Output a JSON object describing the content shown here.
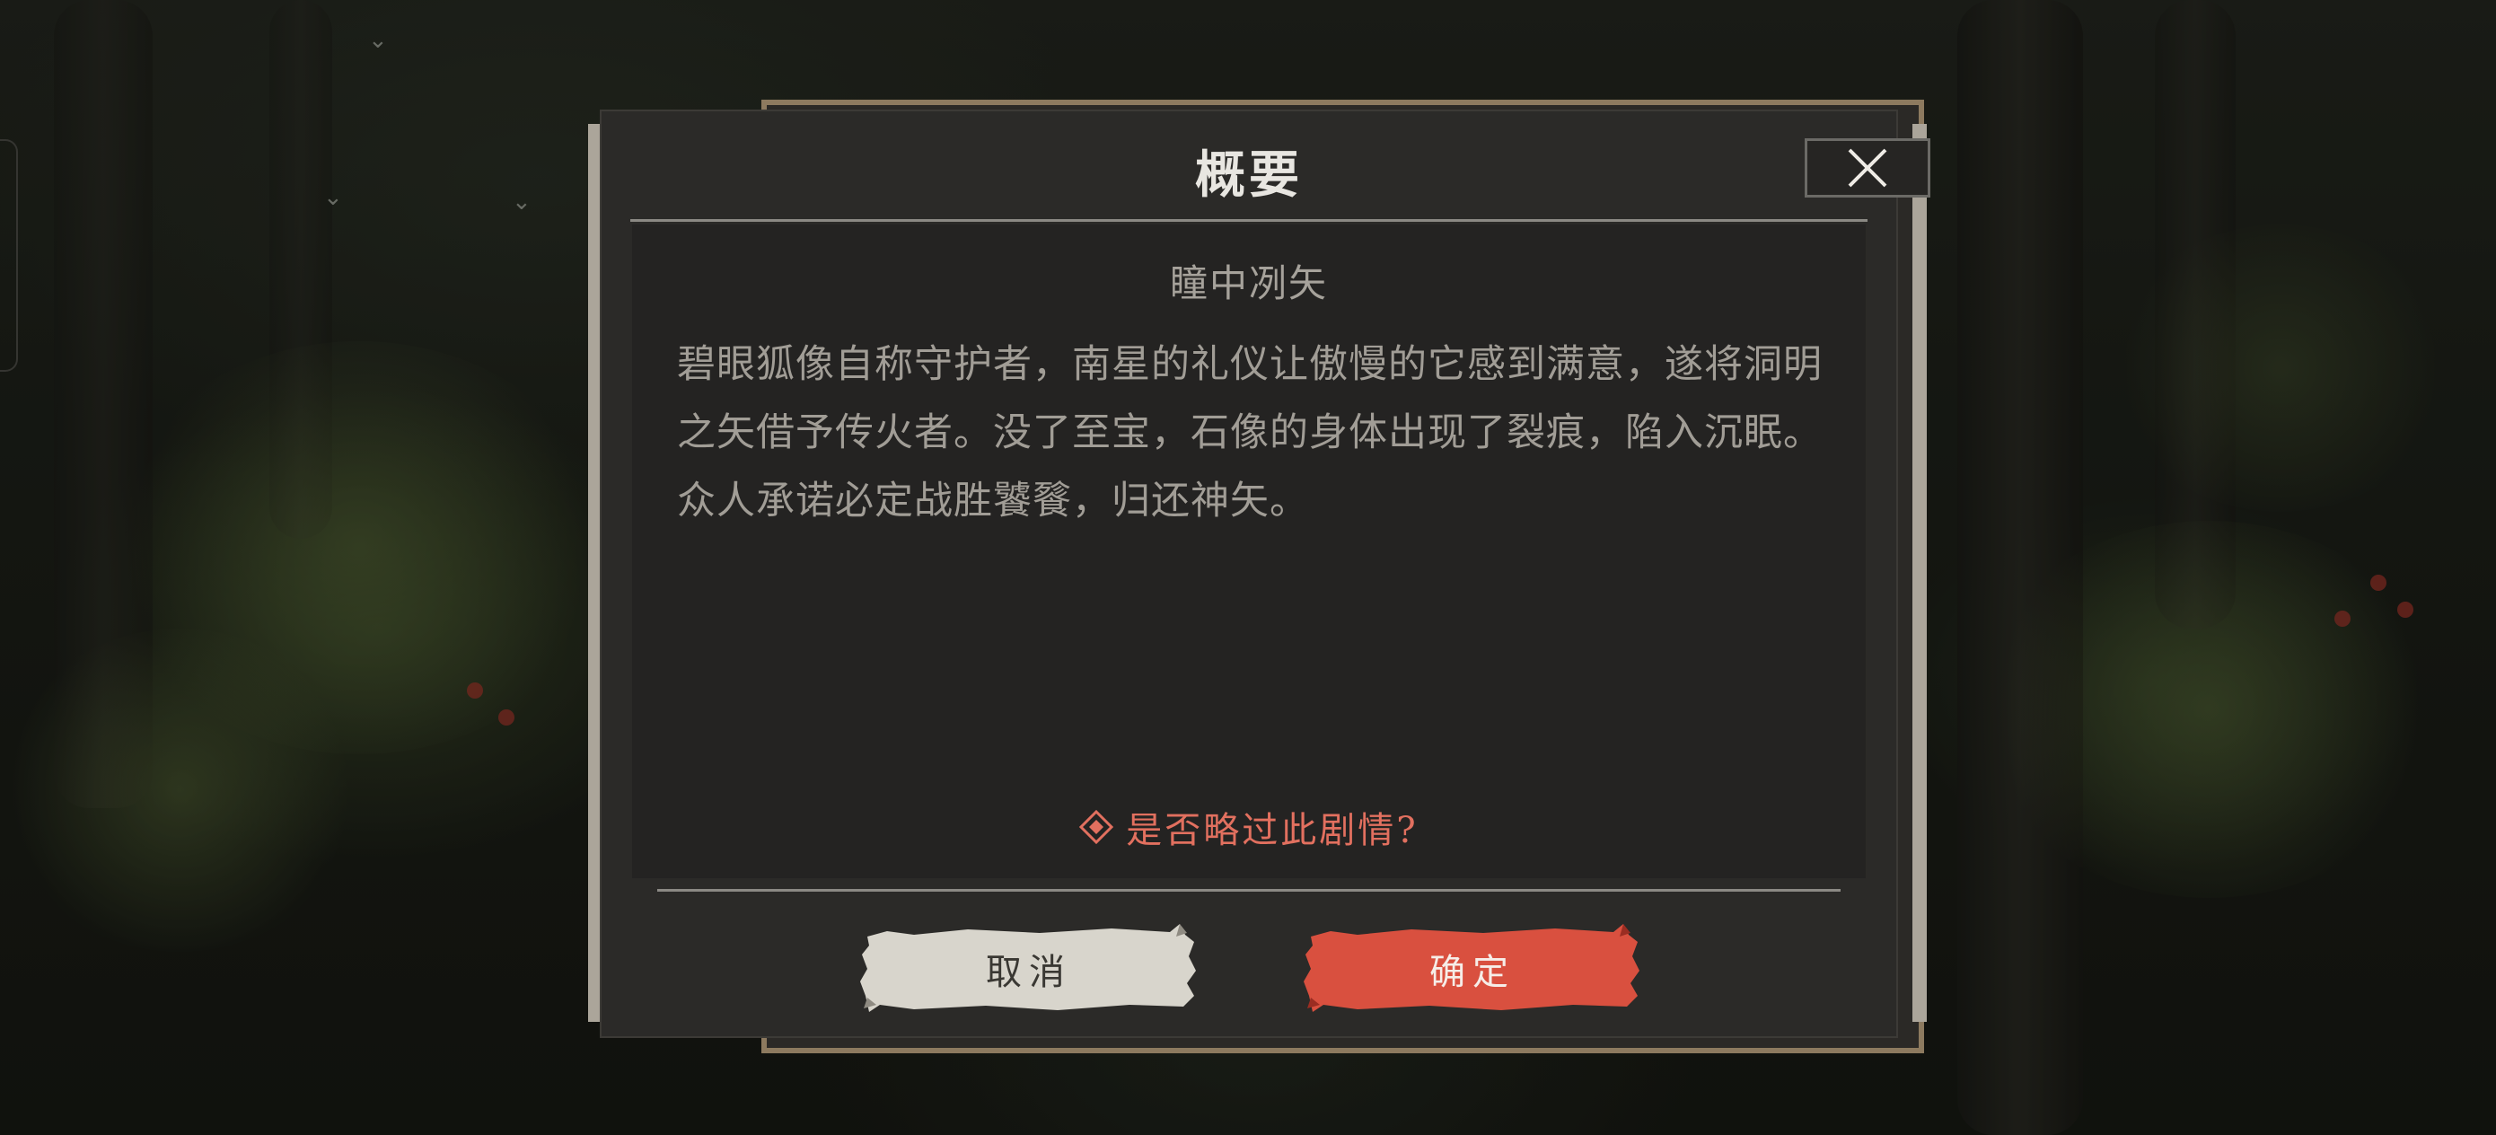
{
  "dialog": {
    "title": "概要",
    "close_icon": "close-icon",
    "chapter_title": "瞳中冽矢",
    "summary": "碧眼狐像自称守护者，南星的礼仪让傲慢的它感到满意，遂将洞明之矢借予传火者。没了至宝，石像的身体出现了裂痕，陷入沉眠。众人承诺必定战胜饕餮，归还神矢。",
    "question_icon": "diamond-icon",
    "question": "是否略过此剧情?",
    "cancel_label": "取消",
    "confirm_label": "确定"
  },
  "colors": {
    "accent": "#e2705f",
    "confirm_button": "#d9503f",
    "cancel_button": "#d8d5cc",
    "panel": "#2b2a28",
    "frame_gold": "#8d7a5f"
  }
}
